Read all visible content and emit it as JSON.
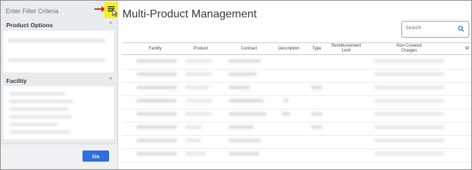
{
  "sidebar": {
    "filter_title": "Enter Filter Criteria",
    "sections": [
      {
        "title": "Product Options"
      },
      {
        "title": "Facility"
      }
    ],
    "go_label": "Go"
  },
  "main": {
    "title": "Multi-Product Management",
    "search_placeholder": "Search",
    "columns": [
      {
        "label": "Facility"
      },
      {
        "label": "Product"
      },
      {
        "label": "Contract"
      },
      {
        "label": "Description"
      },
      {
        "label": "Type"
      },
      {
        "label": "Reimbursement\nLimit"
      },
      {
        "label": "Non-Covered\nCharges"
      },
      {
        "label": "W"
      }
    ]
  },
  "icons": {
    "filter_toggle": "menu-lines-icon",
    "search": "magnifier-icon",
    "arrow": "red-arrow-icon"
  },
  "colors": {
    "accent": "#2f6fdd",
    "highlight": "#f3ef2b",
    "arrow": "#e0201b"
  }
}
